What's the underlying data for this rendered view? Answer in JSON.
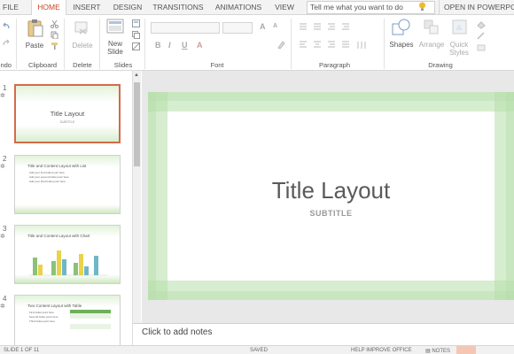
{
  "tabs": [
    {
      "label": "FILE"
    },
    {
      "label": "HOME"
    },
    {
      "label": "INSERT"
    },
    {
      "label": "DESIGN"
    },
    {
      "label": "TRANSITIONS"
    },
    {
      "label": "ANIMATIONS"
    },
    {
      "label": "VIEW"
    }
  ],
  "tell_me": "Tell me what you want to do",
  "open_in": "OPEN IN POWERPOINT",
  "ribbon": {
    "undo_group": "Undo",
    "paste": "Paste",
    "clipboard_group": "Clipboard",
    "delete": "Delete",
    "delete_group": "Delete",
    "new_slide_line1": "New",
    "new_slide_line2": "Slide",
    "slides_group": "Slides",
    "bold": "B",
    "italic": "I",
    "underline": "U",
    "font_color": "A",
    "grow_font": "A",
    "shrink_font": "A",
    "font_group": "Font",
    "paragraph_group": "Paragraph",
    "shapes": "Shapes",
    "arrange": "Arrange",
    "quick_styles_line1": "Quick",
    "quick_styles_line2": "Styles",
    "drawing_group": "Drawing"
  },
  "slides": [
    {
      "num": "1",
      "title": "Title Layout",
      "subtitle": "SUBTITLE"
    },
    {
      "num": "2",
      "title": "Title and Content Layout with List",
      "bullets": [
        "Add your first bullet point here",
        "Add your second bullet point here",
        "Add your third bullet point here"
      ]
    },
    {
      "num": "3",
      "title": "Title and Content Layout with Chart"
    },
    {
      "num": "4",
      "title": "Two Content Layout with Table",
      "bullets": [
        "First bullet point here",
        "Second bullet point here",
        "Third bullet point here"
      ]
    }
  ],
  "main_slide": {
    "title": "Title Layout",
    "subtitle": "SUBTITLE"
  },
  "notes_placeholder": "Click to add notes",
  "status": {
    "slide_count": "SLIDE 1 OF 11",
    "saved": "SAVED",
    "help": "HELP IMPROVE OFFICE",
    "notes": "NOTES"
  },
  "colors": {
    "accent": "#c8432b",
    "selection": "#d46a4a",
    "theme_green": "#b6deaa"
  }
}
